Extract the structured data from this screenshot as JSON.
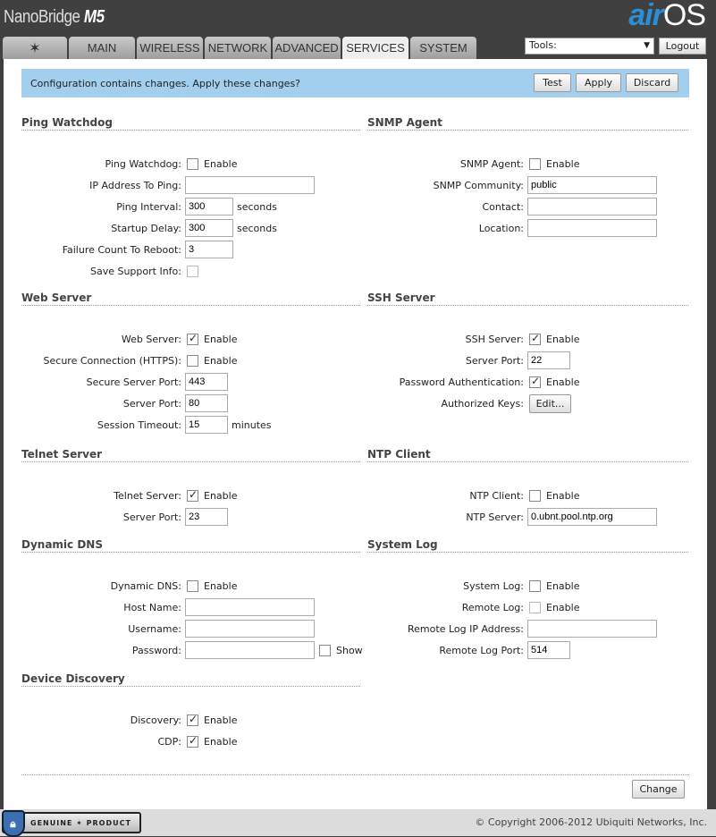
{
  "header": {
    "product": "NanoBridge",
    "model": "M5",
    "logo": "airOS"
  },
  "tabs": [
    {
      "label": "",
      "icon": "ubiquiti-logo-icon"
    },
    {
      "label": "MAIN"
    },
    {
      "label": "WIRELESS"
    },
    {
      "label": "NETWORK"
    },
    {
      "label": "ADVANCED"
    },
    {
      "label": "SERVICES",
      "active": true
    },
    {
      "label": "SYSTEM"
    }
  ],
  "tools": {
    "value": "Tools:"
  },
  "logout": "Logout",
  "banner": {
    "text": "Configuration contains changes. Apply these changes?",
    "test": "Test",
    "apply": "Apply",
    "discard": "Discard"
  },
  "sections": {
    "ping": {
      "title": "Ping Watchdog",
      "rows": [
        {
          "label": "Ping Watchdog:",
          "type": "checkbox",
          "checked": false,
          "text": "Enable"
        },
        {
          "label": "IP Address To Ping:",
          "type": "text",
          "value": ""
        },
        {
          "label": "Ping Interval:",
          "type": "text",
          "value": "300",
          "suffix": "seconds"
        },
        {
          "label": "Startup Delay:",
          "type": "text",
          "value": "300",
          "suffix": "seconds"
        },
        {
          "label": "Failure Count To Reboot:",
          "type": "text",
          "value": "3"
        },
        {
          "label": "Save Support Info:",
          "type": "checkbox",
          "checked": false,
          "disabled": true
        }
      ]
    },
    "snmp": {
      "title": "SNMP Agent",
      "rows": [
        {
          "label": "SNMP Agent:",
          "type": "checkbox",
          "checked": false,
          "text": "Enable"
        },
        {
          "label": "SNMP Community:",
          "type": "text",
          "value": "public"
        },
        {
          "label": "Contact:",
          "type": "text",
          "value": ""
        },
        {
          "label": "Location:",
          "type": "text",
          "value": ""
        }
      ]
    },
    "web": {
      "title": "Web Server",
      "rows": [
        {
          "label": "Web Server:",
          "type": "checkbox",
          "checked": true,
          "text": "Enable"
        },
        {
          "label": "Secure Connection (HTTPS):",
          "type": "checkbox",
          "checked": false,
          "text": "Enable"
        },
        {
          "label": "Secure Server Port:",
          "type": "text",
          "value": "443"
        },
        {
          "label": "Server Port:",
          "type": "text",
          "value": "80"
        },
        {
          "label": "Session Timeout:",
          "type": "text",
          "value": "15",
          "suffix": "minutes"
        }
      ]
    },
    "ssh": {
      "title": "SSH Server",
      "rows": [
        {
          "label": "SSH Server:",
          "type": "checkbox",
          "checked": true,
          "text": "Enable"
        },
        {
          "label": "Server Port:",
          "type": "text",
          "value": "22"
        },
        {
          "label": "Password Authentication:",
          "type": "checkbox",
          "checked": true,
          "text": "Enable"
        },
        {
          "label": "Authorized Keys:",
          "type": "button",
          "text": "Edit..."
        }
      ]
    },
    "telnet": {
      "title": "Telnet Server",
      "rows": [
        {
          "label": "Telnet Server:",
          "type": "checkbox",
          "checked": true,
          "text": "Enable"
        },
        {
          "label": "Server Port:",
          "type": "text",
          "value": "23"
        }
      ]
    },
    "ntp": {
      "title": "NTP Client",
      "rows": [
        {
          "label": "NTP Client:",
          "type": "checkbox",
          "checked": false,
          "text": "Enable"
        },
        {
          "label": "NTP Server:",
          "type": "text",
          "value": "0.ubnt.pool.ntp.org"
        }
      ]
    },
    "ddns": {
      "title": "Dynamic DNS",
      "rows": [
        {
          "label": "Dynamic DNS:",
          "type": "checkbox",
          "checked": false,
          "text": "Enable"
        },
        {
          "label": "Host Name:",
          "type": "text",
          "value": ""
        },
        {
          "label": "Username:",
          "type": "text",
          "value": ""
        },
        {
          "label": "Password:",
          "type": "password",
          "value": "",
          "show": "Show"
        }
      ]
    },
    "syslog": {
      "title": "System Log",
      "rows": [
        {
          "label": "System Log:",
          "type": "checkbox",
          "checked": false,
          "text": "Enable"
        },
        {
          "label": "Remote Log:",
          "type": "checkbox",
          "checked": false,
          "disabled": true,
          "text": "Enable"
        },
        {
          "label": "Remote Log IP Address:",
          "type": "text",
          "value": ""
        },
        {
          "label": "Remote Log Port:",
          "type": "text",
          "value": "514"
        }
      ]
    },
    "discovery": {
      "title": "Device Discovery",
      "rows": [
        {
          "label": "Discovery:",
          "type": "checkbox",
          "checked": true,
          "text": "Enable"
        },
        {
          "label": "CDP:",
          "type": "checkbox",
          "checked": true,
          "text": "Enable"
        }
      ]
    }
  },
  "change": "Change",
  "footer": {
    "badge": "GENUINE PRODUCT",
    "copyright": "© Copyright 2006-2012 Ubiquiti Networks, Inc."
  }
}
